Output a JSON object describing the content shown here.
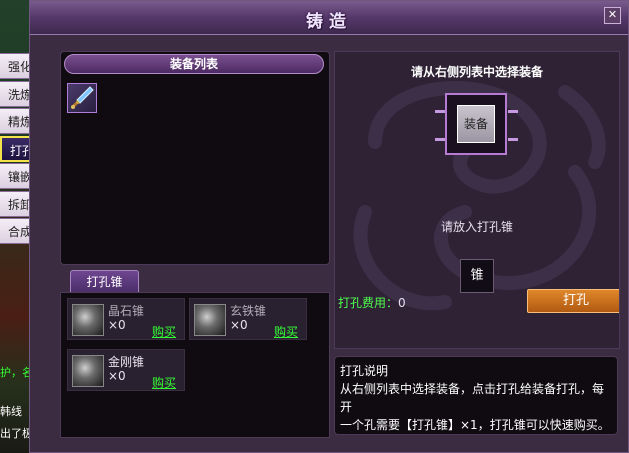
{
  "window": {
    "title": "铸造",
    "close_label": "✕"
  },
  "side_tabs": [
    {
      "label": "强化",
      "active": false
    },
    {
      "label": "洗炼",
      "active": false
    },
    {
      "label": "精炼",
      "active": false
    },
    {
      "label": "打孔",
      "active": true
    },
    {
      "label": "镶嵌",
      "active": false
    },
    {
      "label": "拆卸",
      "active": false
    },
    {
      "label": "合成",
      "active": false
    }
  ],
  "background_text": {
    "line1": "护，名",
    "line2": "韩线",
    "line3": "出了极品"
  },
  "equipment_list": {
    "header": "装备列表",
    "slot_icon": "sword-item-icon"
  },
  "drills": {
    "tab_label": "打孔锥",
    "items": [
      {
        "name": "晶石锥",
        "count": "×0",
        "buy_label": "购买",
        "icon": "crystal-drill-icon"
      },
      {
        "name": "玄铁锥",
        "count": "×0",
        "buy_label": "购买",
        "icon": "iron-drill-icon"
      },
      {
        "name": "金刚锥",
        "count": "×0",
        "buy_label": "购买",
        "icon": "diamond-drill-icon"
      }
    ]
  },
  "right_panel": {
    "instruction": "请从右侧列表中选择装备",
    "equip_slot_label": "装备",
    "place_drill_prompt": "请放入打孔锥",
    "drill_slot_label": "锥",
    "fee_label": "打孔费用：",
    "fee_value": "0",
    "punch_button": "打孔"
  },
  "help": {
    "title": "打孔说明",
    "line1": "从右侧列表中选择装备，点击打孔给装备打孔，每开",
    "line2": "一个孔需要【打孔锥】×1，打孔锥可以快速购买。"
  },
  "colors": {
    "accent_purple": "#55386a",
    "buy_green": "#33ff33",
    "fee_green": "#4dff4d",
    "active_tab_border": "#f3e24a",
    "punch_button": "#e0872a"
  }
}
